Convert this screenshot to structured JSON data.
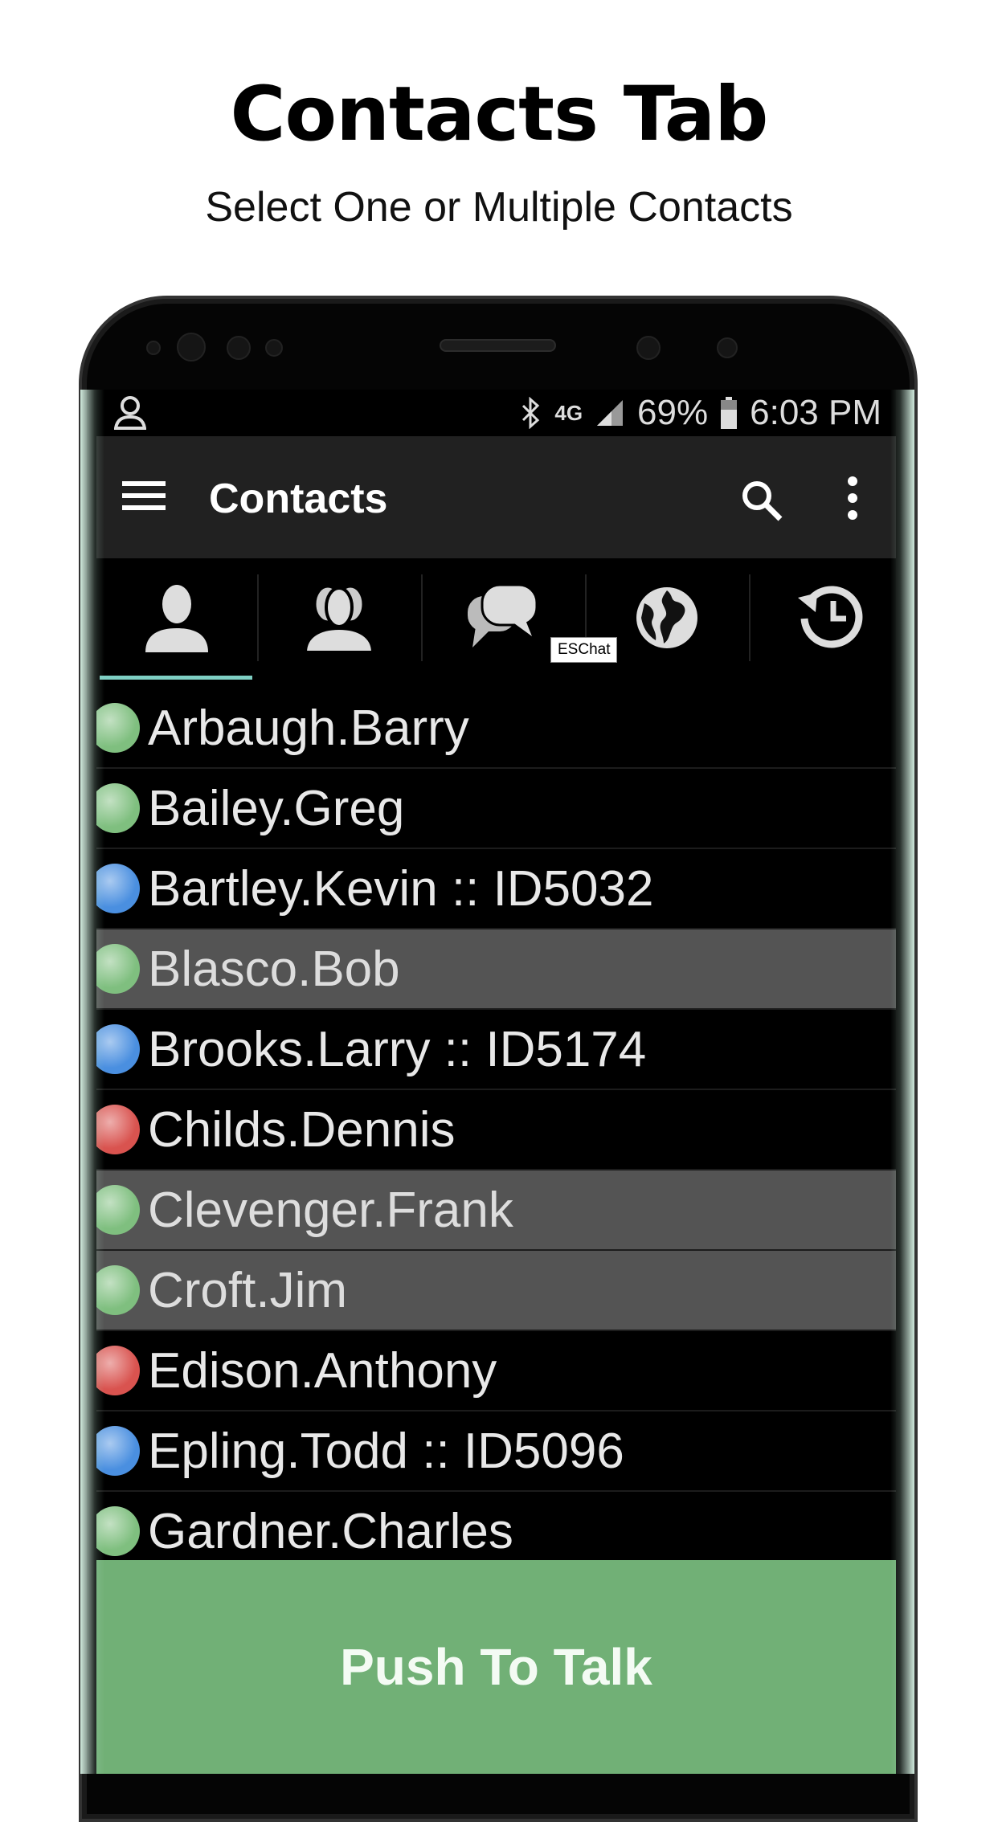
{
  "header": {
    "title": "Contacts Tab",
    "subtitle": "Select One or Multiple Contacts"
  },
  "status_bar": {
    "network": "4G",
    "battery": "69%",
    "time": "6:03 PM"
  },
  "toolbar": {
    "title": "Contacts"
  },
  "tabs": [
    {
      "icon": "person-icon",
      "active": true
    },
    {
      "icon": "group-icon",
      "active": false
    },
    {
      "icon": "chat-icon",
      "active": false
    },
    {
      "icon": "globe-icon",
      "active": false,
      "badge": "ESChat"
    },
    {
      "icon": "history-icon",
      "active": false
    }
  ],
  "colors": {
    "green": "#7fbf7f",
    "blue": "#4a8fe0",
    "red": "#d9534f",
    "selected_row": "#545454",
    "ptt": "#71b076",
    "tab_indicator": "#7fd0c4"
  },
  "contacts": [
    {
      "name": "Arbaugh.Barry",
      "status": "green",
      "selected": false
    },
    {
      "name": "Bailey.Greg",
      "status": "green",
      "selected": false
    },
    {
      "name": "Bartley.Kevin :: ID5032",
      "status": "blue",
      "selected": false
    },
    {
      "name": "Blasco.Bob",
      "status": "green",
      "selected": true
    },
    {
      "name": "Brooks.Larry :: ID5174",
      "status": "blue",
      "selected": false
    },
    {
      "name": "Childs.Dennis",
      "status": "red",
      "selected": false
    },
    {
      "name": "Clevenger.Frank",
      "status": "green",
      "selected": true
    },
    {
      "name": "Croft.Jim",
      "status": "green",
      "selected": true
    },
    {
      "name": "Edison.Anthony",
      "status": "red",
      "selected": false
    },
    {
      "name": "Epling.Todd :: ID5096",
      "status": "blue",
      "selected": false
    },
    {
      "name": "Gardner.Charles",
      "status": "green",
      "selected": false
    }
  ],
  "ptt_button": {
    "label": "Push To Talk"
  }
}
